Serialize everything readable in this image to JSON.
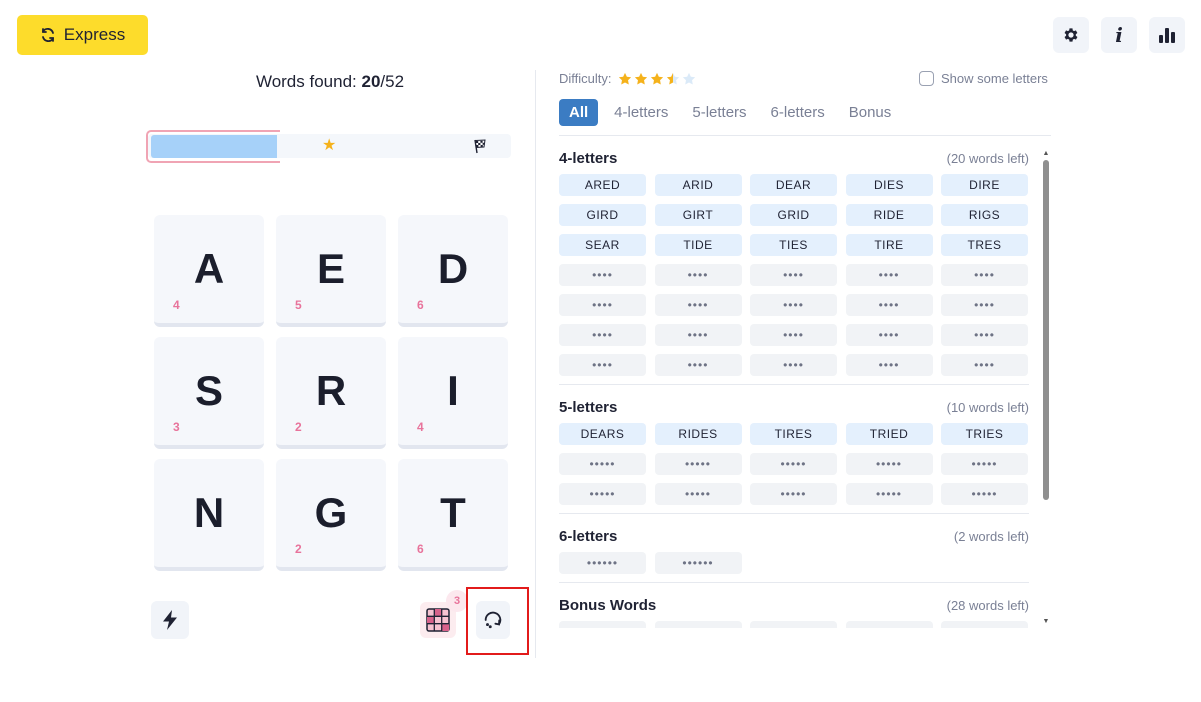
{
  "header": {
    "express_label": "Express",
    "icons": [
      "gear-icon",
      "info-icon",
      "stats-icon"
    ]
  },
  "game": {
    "found_label": "Words found:",
    "found": "20",
    "total": "/52",
    "progress": 0.38,
    "tiles": [
      {
        "letter": "A",
        "points": "4"
      },
      {
        "letter": "E",
        "points": "5"
      },
      {
        "letter": "D",
        "points": "6"
      },
      {
        "letter": "S",
        "points": "3"
      },
      {
        "letter": "R",
        "points": "2"
      },
      {
        "letter": "I",
        "points": "4"
      },
      {
        "letter": "N",
        "points": ""
      },
      {
        "letter": "G",
        "points": "2"
      },
      {
        "letter": "T",
        "points": "6"
      }
    ],
    "grid_badge": "3"
  },
  "panel": {
    "difficulty_label": "Difficulty:",
    "difficulty_stars": 3.5,
    "difficulty_max": 5,
    "show_letters_label": "Show some letters",
    "tabs": [
      {
        "label": "All",
        "active": true
      },
      {
        "label": "4-letters",
        "active": false
      },
      {
        "label": "5-letters",
        "active": false
      },
      {
        "label": "6-letters",
        "active": false
      },
      {
        "label": "Bonus",
        "active": false
      }
    ],
    "sections": [
      {
        "title": "4-letters",
        "left": "(20 words left)",
        "found": [
          "ARED",
          "ARID",
          "DEAR",
          "DIES",
          "DIRE",
          "GIRD",
          "GIRT",
          "GRID",
          "RIDE",
          "RIGS",
          "SEAR",
          "TIDE",
          "TIES",
          "TIRE",
          "TRES"
        ],
        "hidden": [
          "••••",
          "••••",
          "••••",
          "••••",
          "••••",
          "••••",
          "••••",
          "••••",
          "••••",
          "••••",
          "••••",
          "••••",
          "••••",
          "••••",
          "••••",
          "••••",
          "••••",
          "••••",
          "••••",
          "••••"
        ]
      },
      {
        "title": "5-letters",
        "left": "(10 words left)",
        "found": [
          "DEARS",
          "RIDES",
          "TIRES",
          "TRIED",
          "TRIES"
        ],
        "hidden": [
          "•••••",
          "•••••",
          "•••••",
          "•••••",
          "•••••",
          "•••••",
          "•••••",
          "•••••",
          "•••••",
          "•••••"
        ]
      },
      {
        "title": "6-letters",
        "left": "(2 words left)",
        "found": [],
        "hidden": [
          "••••••",
          "••••••"
        ]
      },
      {
        "title": "Bonus Words",
        "left": "(28 words left)",
        "found": [],
        "hidden": [
          "••••",
          "••••••",
          "••••",
          "••••••",
          "••••"
        ]
      }
    ]
  },
  "colors": {
    "accent": "#3b7cc3",
    "express": "#fddc2b",
    "points": "#e8739b",
    "found_chip": "#e4f0fd",
    "highlight": "#e21b1b"
  }
}
